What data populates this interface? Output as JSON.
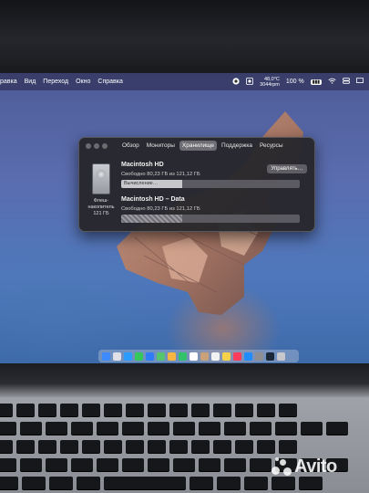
{
  "menubar": {
    "items": [
      "равка",
      "Вид",
      "Переход",
      "Окно",
      "Справка"
    ],
    "temp_top": "48,0°C",
    "temp_bottom": "3044rpm",
    "battery_percent": "100 %",
    "clock": ""
  },
  "window": {
    "tabs": [
      "Обзор",
      "Мониторы",
      "Хранилище",
      "Поддержка",
      "Ресурсы"
    ],
    "active_tab": "Хранилище",
    "disk_caption_line1": "Флеш-",
    "disk_caption_line2": "накопитель",
    "disk_caption_line3": "121 ГБ",
    "volumes": [
      {
        "name": "Macintosh HD",
        "free_text": "Свободно 80,23 ГБ из 121,12 ГБ",
        "bar_label": "Вычисление…",
        "used_fraction": 0.34
      },
      {
        "name": "Macintosh HD – Data",
        "free_text": "Свободно 80,23 ГБ из 121,12 ГБ",
        "used_fraction": 0.34
      }
    ],
    "manage_button": "Управлять…"
  },
  "dock": {
    "icons": [
      "finder-icon",
      "launchpad-icon",
      "safari-icon",
      "messages-icon",
      "mail-icon",
      "maps-icon",
      "photos-icon",
      "facetime-icon",
      "calendar-icon",
      "contacts-icon",
      "reminders-icon",
      "notes-icon",
      "music-icon",
      "appstore-icon",
      "settings-icon",
      "steam-icon",
      "trash-icon"
    ],
    "colors": [
      "#3d8bff",
      "#e0e0e8",
      "#2a9bff",
      "#34c759",
      "#2f7df6",
      "#54c46f",
      "#f5b642",
      "#31c26a",
      "#ffffff",
      "#c9a27a",
      "#f2f2f2",
      "#f6d24a",
      "#fb3c5a",
      "#1f8cff",
      "#8e8e93",
      "#1b2838",
      "#c7c7cc"
    ]
  },
  "watermark": {
    "text": "Avito"
  }
}
